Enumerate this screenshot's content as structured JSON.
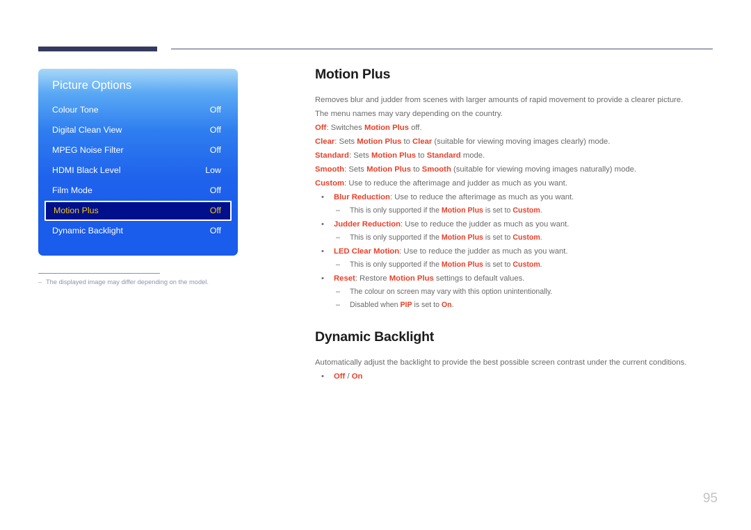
{
  "page": {
    "number": "95",
    "accent_red": "#e8402a",
    "header_bar_color": "#34395e",
    "body_text_color": "#6a6a6a"
  },
  "osd": {
    "title": "Picture Options",
    "selected_index": 5,
    "highlight_bg": "#00108c",
    "highlight_text": "#f5c518",
    "items": [
      {
        "label": "Colour Tone",
        "value": "Off"
      },
      {
        "label": "Digital Clean View",
        "value": "Off"
      },
      {
        "label": "MPEG Noise Filter",
        "value": "Off"
      },
      {
        "label": "HDMI Black Level",
        "value": "Low"
      },
      {
        "label": "Film Mode",
        "value": "Off"
      },
      {
        "label": "Motion Plus",
        "value": "Off"
      },
      {
        "label": "Dynamic Backlight",
        "value": "Off"
      }
    ]
  },
  "note": {
    "dash": "–",
    "text": "The displayed image may differ depending on the model."
  },
  "sections": {
    "motion_plus": {
      "heading": "Motion Plus",
      "intro_1": "Removes blur and judder from scenes with larger amounts of rapid movement to provide a clearer picture.",
      "intro_2": "The menu names may vary depending on the country.",
      "modes": [
        {
          "key": "Off",
          "t1": ": Switches ",
          "ref": "Motion Plus",
          "t2": " off."
        },
        {
          "key": "Clear",
          "t1": ": Sets ",
          "ref": "Motion Plus",
          "t2": " to ",
          "key2": "Clear",
          "t3": " (suitable for viewing moving images clearly) mode."
        },
        {
          "key": "Standard",
          "t1": ": Sets ",
          "ref": "Motion Plus",
          "t2": " to ",
          "key2": "Standard",
          "t3": " mode."
        },
        {
          "key": "Smooth",
          "t1": ": Sets ",
          "ref": "Motion Plus",
          "t2": " to ",
          "key2": "Smooth",
          "t3": " (suitable for viewing moving images naturally) mode."
        },
        {
          "key": "Custom",
          "t1": ": Use to reduce the afterimage and judder as much as you want."
        }
      ],
      "bullets": [
        {
          "key": "Blur Reduction",
          "text": ": Use to reduce the afterimage as much as you want.",
          "sub": [
            {
              "pre": "This is only supported if the ",
              "ref": "Motion Plus",
              "mid": " is set to ",
              "ref2": "Custom",
              "post": "."
            }
          ]
        },
        {
          "key": "Judder Reduction",
          "text": ": Use to reduce the judder as much as you want.",
          "sub": [
            {
              "pre": "This is only supported if the ",
              "ref": "Motion Plus",
              "mid": " is set to ",
              "ref2": "Custom",
              "post": "."
            }
          ]
        },
        {
          "key": "LED Clear Motion",
          "text": ": Use to reduce the judder as much as you want.",
          "sub": [
            {
              "pre": "This is only supported if the ",
              "ref": "Motion Plus",
              "mid": " is set to ",
              "ref2": "Custom",
              "post": "."
            }
          ]
        },
        {
          "key": "Reset",
          "text": ": Restore ",
          "ref": "Motion Plus",
          "text_after": " settings to default values.",
          "sub": [
            {
              "pre": "The colour on screen may vary with this option unintentionally."
            },
            {
              "pre": "Disabled when ",
              "ref": "PIP",
              "mid": " is set to ",
              "ref2": "On",
              "post": "."
            }
          ]
        }
      ]
    },
    "dynamic_backlight": {
      "heading": "Dynamic Backlight",
      "intro": "Automatically adjust the backlight to provide the best possible screen contrast under the current conditions.",
      "option_left": "Off",
      "option_sep": " / ",
      "option_right": "On"
    }
  },
  "glyphs": {
    "bullet_dot": "•",
    "bullet_dash": "–"
  }
}
